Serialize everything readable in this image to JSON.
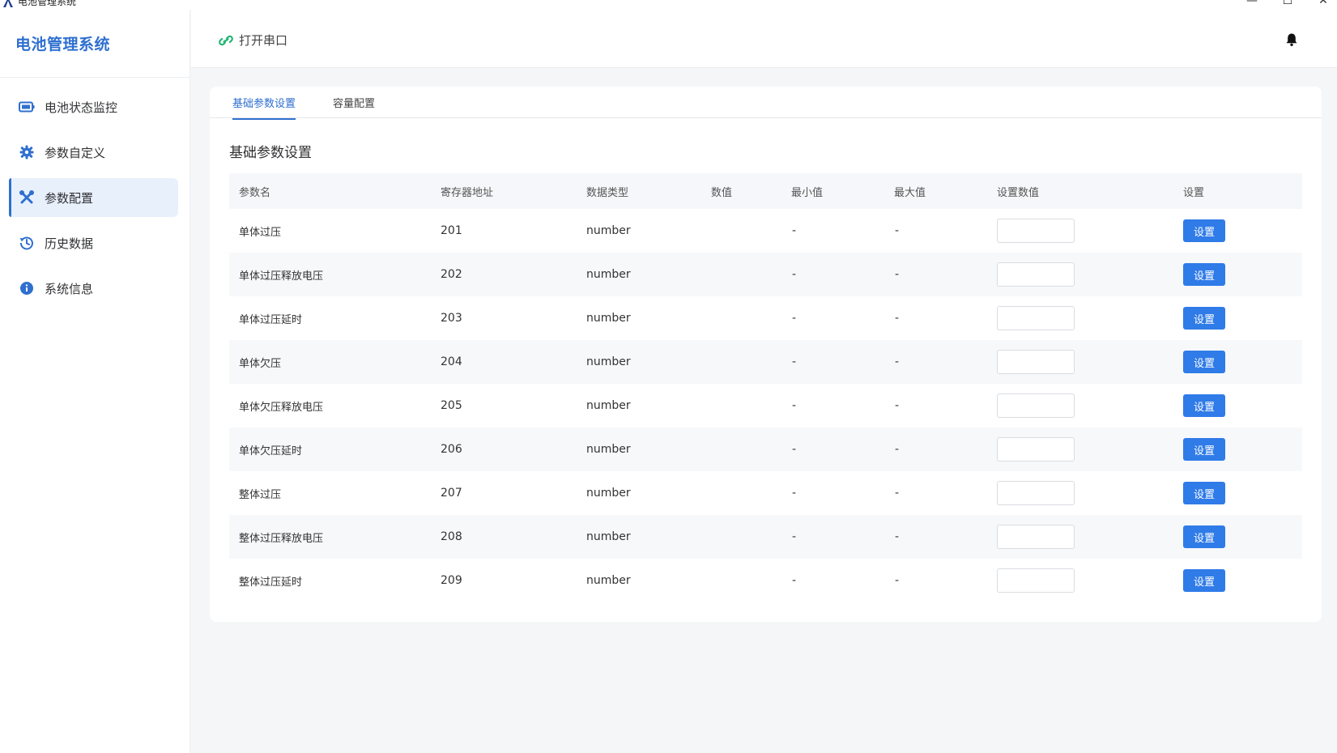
{
  "window": {
    "title": "电池管理系统",
    "minimize": "—",
    "maximize": "☐",
    "close": "✕"
  },
  "sidebar": {
    "brand": "电池管理系统",
    "items": [
      {
        "label": "电池状态监控",
        "icon": "battery-icon"
      },
      {
        "label": "参数自定义",
        "icon": "gear-icon"
      },
      {
        "label": "参数配置",
        "icon": "tools-icon",
        "active": true
      },
      {
        "label": "历史数据",
        "icon": "history-icon"
      },
      {
        "label": "系统信息",
        "icon": "info-icon"
      }
    ]
  },
  "header": {
    "serial_label": "打开串口",
    "icons": [
      "link-icon",
      "bell-icon"
    ]
  },
  "tabs": [
    {
      "label": "基础参数设置",
      "active": true
    },
    {
      "label": "容量配置",
      "active": false
    }
  ],
  "section_title": "基础参数设置",
  "table": {
    "columns": [
      "参数名",
      "寄存器地址",
      "数据类型",
      "数值",
      "最小值",
      "最大值",
      "设置数值",
      "设置"
    ],
    "rows": [
      {
        "name": "单体过压",
        "address": "201",
        "type": "number",
        "value": "",
        "min": "-",
        "max": "-",
        "input": "",
        "button": "设置"
      },
      {
        "name": "单体过压释放电压",
        "address": "202",
        "type": "number",
        "value": "",
        "min": "-",
        "max": "-",
        "input": "",
        "button": "设置"
      },
      {
        "name": "单体过压延时",
        "address": "203",
        "type": "number",
        "value": "",
        "min": "-",
        "max": "-",
        "input": "",
        "button": "设置"
      },
      {
        "name": "单体欠压",
        "address": "204",
        "type": "number",
        "value": "",
        "min": "-",
        "max": "-",
        "input": "",
        "button": "设置"
      },
      {
        "name": "单体欠压释放电压",
        "address": "205",
        "type": "number",
        "value": "",
        "min": "-",
        "max": "-",
        "input": "",
        "button": "设置"
      },
      {
        "name": "单体欠压延时",
        "address": "206",
        "type": "number",
        "value": "",
        "min": "-",
        "max": "-",
        "input": "",
        "button": "设置"
      },
      {
        "name": "整体过压",
        "address": "207",
        "type": "number",
        "value": "",
        "min": "-",
        "max": "-",
        "input": "",
        "button": "设置"
      },
      {
        "name": "整体过压释放电压",
        "address": "208",
        "type": "number",
        "value": "",
        "min": "-",
        "max": "-",
        "input": "",
        "button": "设置"
      },
      {
        "name": "整体过压延时",
        "address": "209",
        "type": "number",
        "value": "",
        "min": "-",
        "max": "-",
        "input": "",
        "button": "设置"
      }
    ]
  },
  "colors": {
    "accent": "#2f6fcf",
    "button": "#2f7be8",
    "link_icon": "#22b573"
  }
}
